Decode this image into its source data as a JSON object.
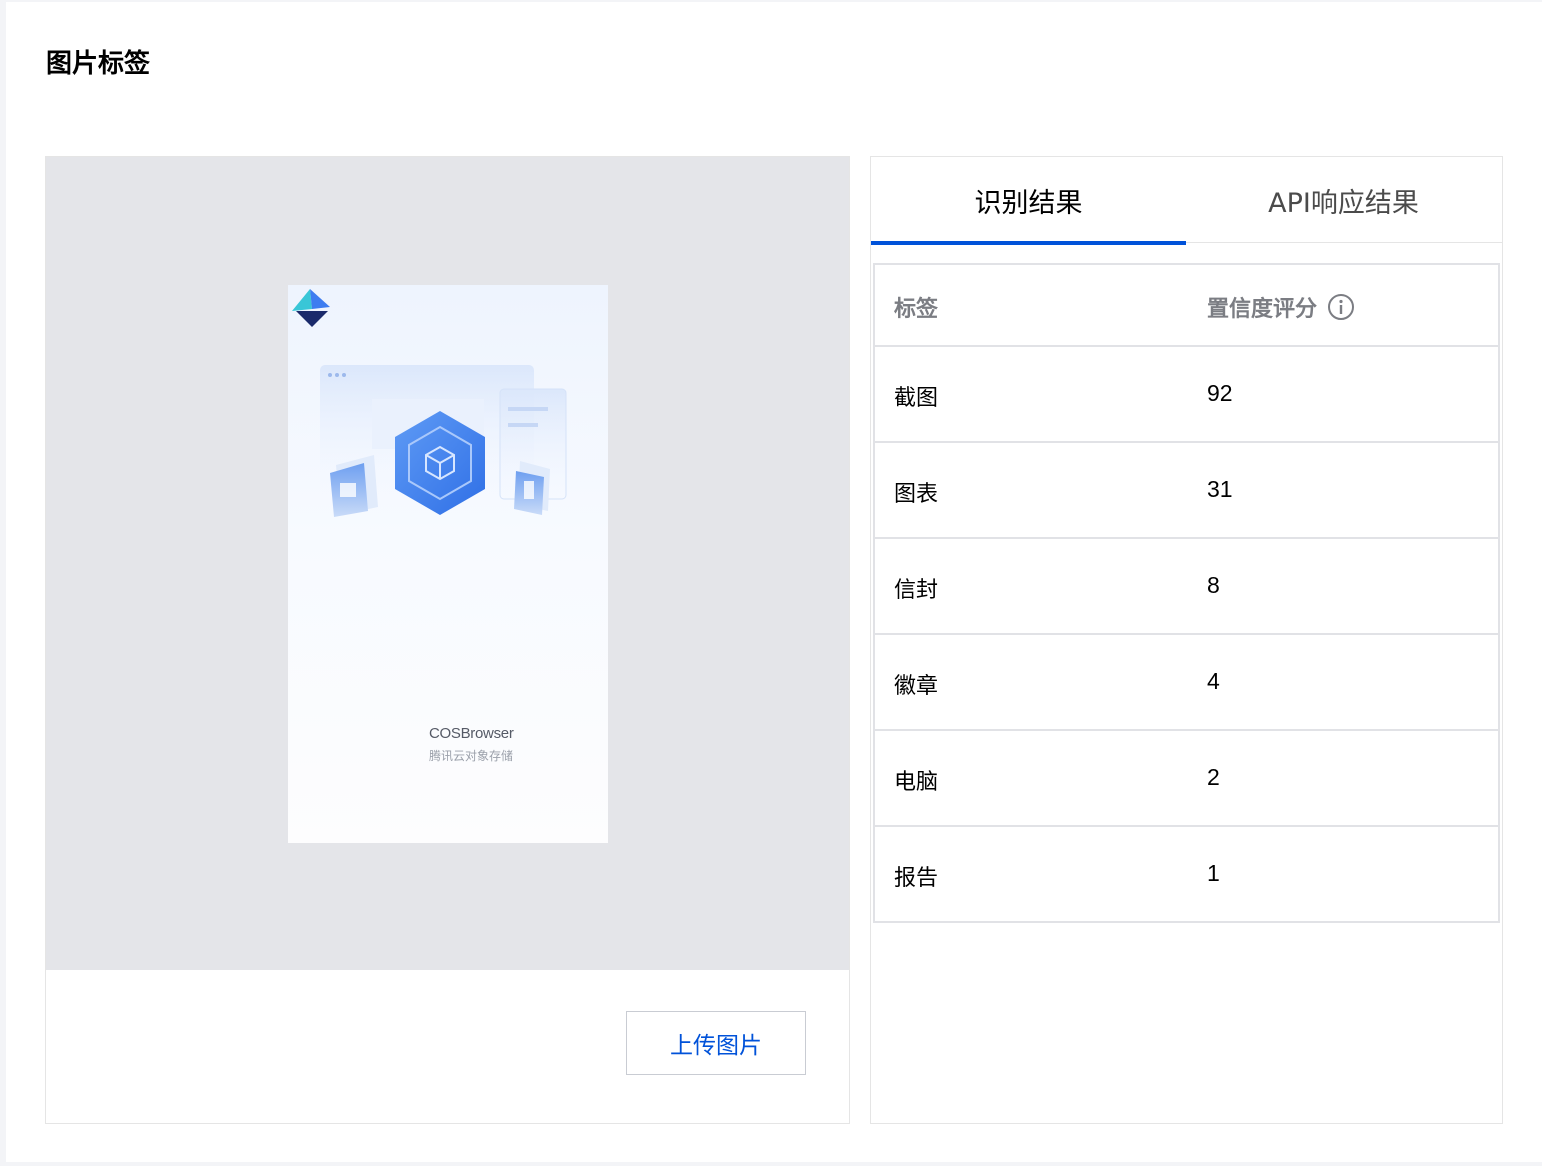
{
  "page": {
    "title": "图片标签"
  },
  "preview": {
    "brand_name": "COSBrowser",
    "brand_sub": "腾讯云对象存储"
  },
  "upload": {
    "label": "上传图片"
  },
  "tabs": [
    {
      "label": "识别结果",
      "active": true
    },
    {
      "label": "API响应结果",
      "active": false
    }
  ],
  "table": {
    "headers": {
      "label": "标签",
      "score": "置信度评分",
      "score_icon": "info-icon"
    },
    "rows": [
      {
        "label": "截图",
        "score": "92"
      },
      {
        "label": "图表",
        "score": "31"
      },
      {
        "label": "信封",
        "score": "8"
      },
      {
        "label": "徽章",
        "score": "4"
      },
      {
        "label": "电脑",
        "score": "2"
      },
      {
        "label": "报告",
        "score": "1"
      }
    ]
  },
  "colors": {
    "accent": "#0052d9",
    "preview_bg": "#e4e5e9",
    "border": "#e1e2e6"
  }
}
